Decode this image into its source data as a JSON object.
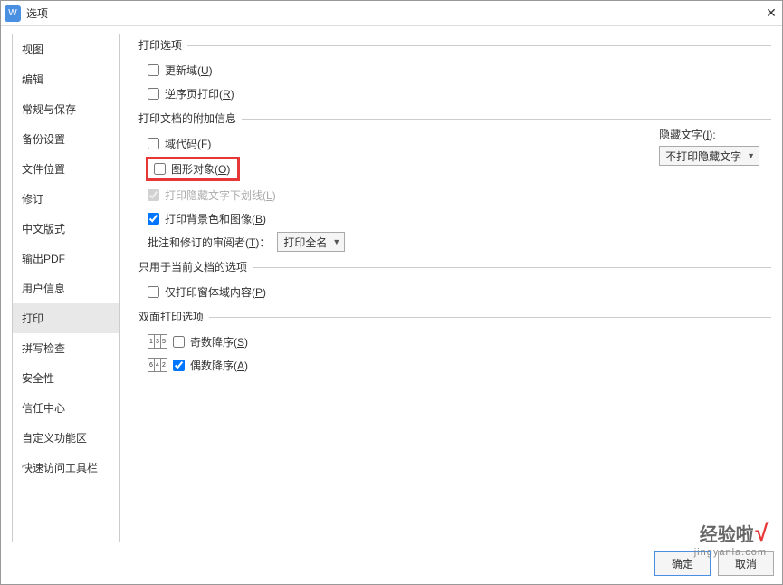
{
  "window": {
    "title": "选项",
    "close": "✕"
  },
  "sidebar": {
    "items": [
      {
        "label": "视图"
      },
      {
        "label": "编辑"
      },
      {
        "label": "常规与保存"
      },
      {
        "label": "备份设置"
      },
      {
        "label": "文件位置"
      },
      {
        "label": "修订"
      },
      {
        "label": "中文版式"
      },
      {
        "label": "输出PDF"
      },
      {
        "label": "用户信息"
      },
      {
        "label": "打印"
      },
      {
        "label": "拼写检查"
      },
      {
        "label": "安全性"
      },
      {
        "label": "信任中心"
      },
      {
        "label": "自定义功能区"
      },
      {
        "label": "快速访问工具栏"
      }
    ],
    "activeIndex": 9
  },
  "groups": {
    "printOptions": {
      "title": "打印选项",
      "updateFields": "更新域(U)",
      "reversePrint": "逆序页打印(R)"
    },
    "docInfo": {
      "title": "打印文档的附加信息",
      "fieldCodes": "域代码(F)",
      "graphicObjects": "图形对象(O)",
      "hiddenTextUnderline": "打印隐藏文字下划线(L)",
      "backgroundImages": "打印背景色和图像(B)",
      "reviewerLabel": "批注和修订的审阅者(T)：",
      "reviewerValue": "打印全名",
      "hiddenTextLabel": "隐藏文字(I):",
      "hiddenTextValue": "不打印隐藏文字"
    },
    "currentDoc": {
      "title": "只用于当前文档的选项",
      "formFieldsOnly": "仅打印窗体域内容(P)"
    },
    "duplex": {
      "title": "双面打印选项",
      "oddDesc": "奇数降序(S)",
      "evenDesc": "偶数降序(A)"
    }
  },
  "footer": {
    "ok": "确定",
    "cancel": "取消"
  },
  "watermark": {
    "line1a": "经验啦",
    "line1b": "√",
    "line2": "jingyanla.com"
  }
}
